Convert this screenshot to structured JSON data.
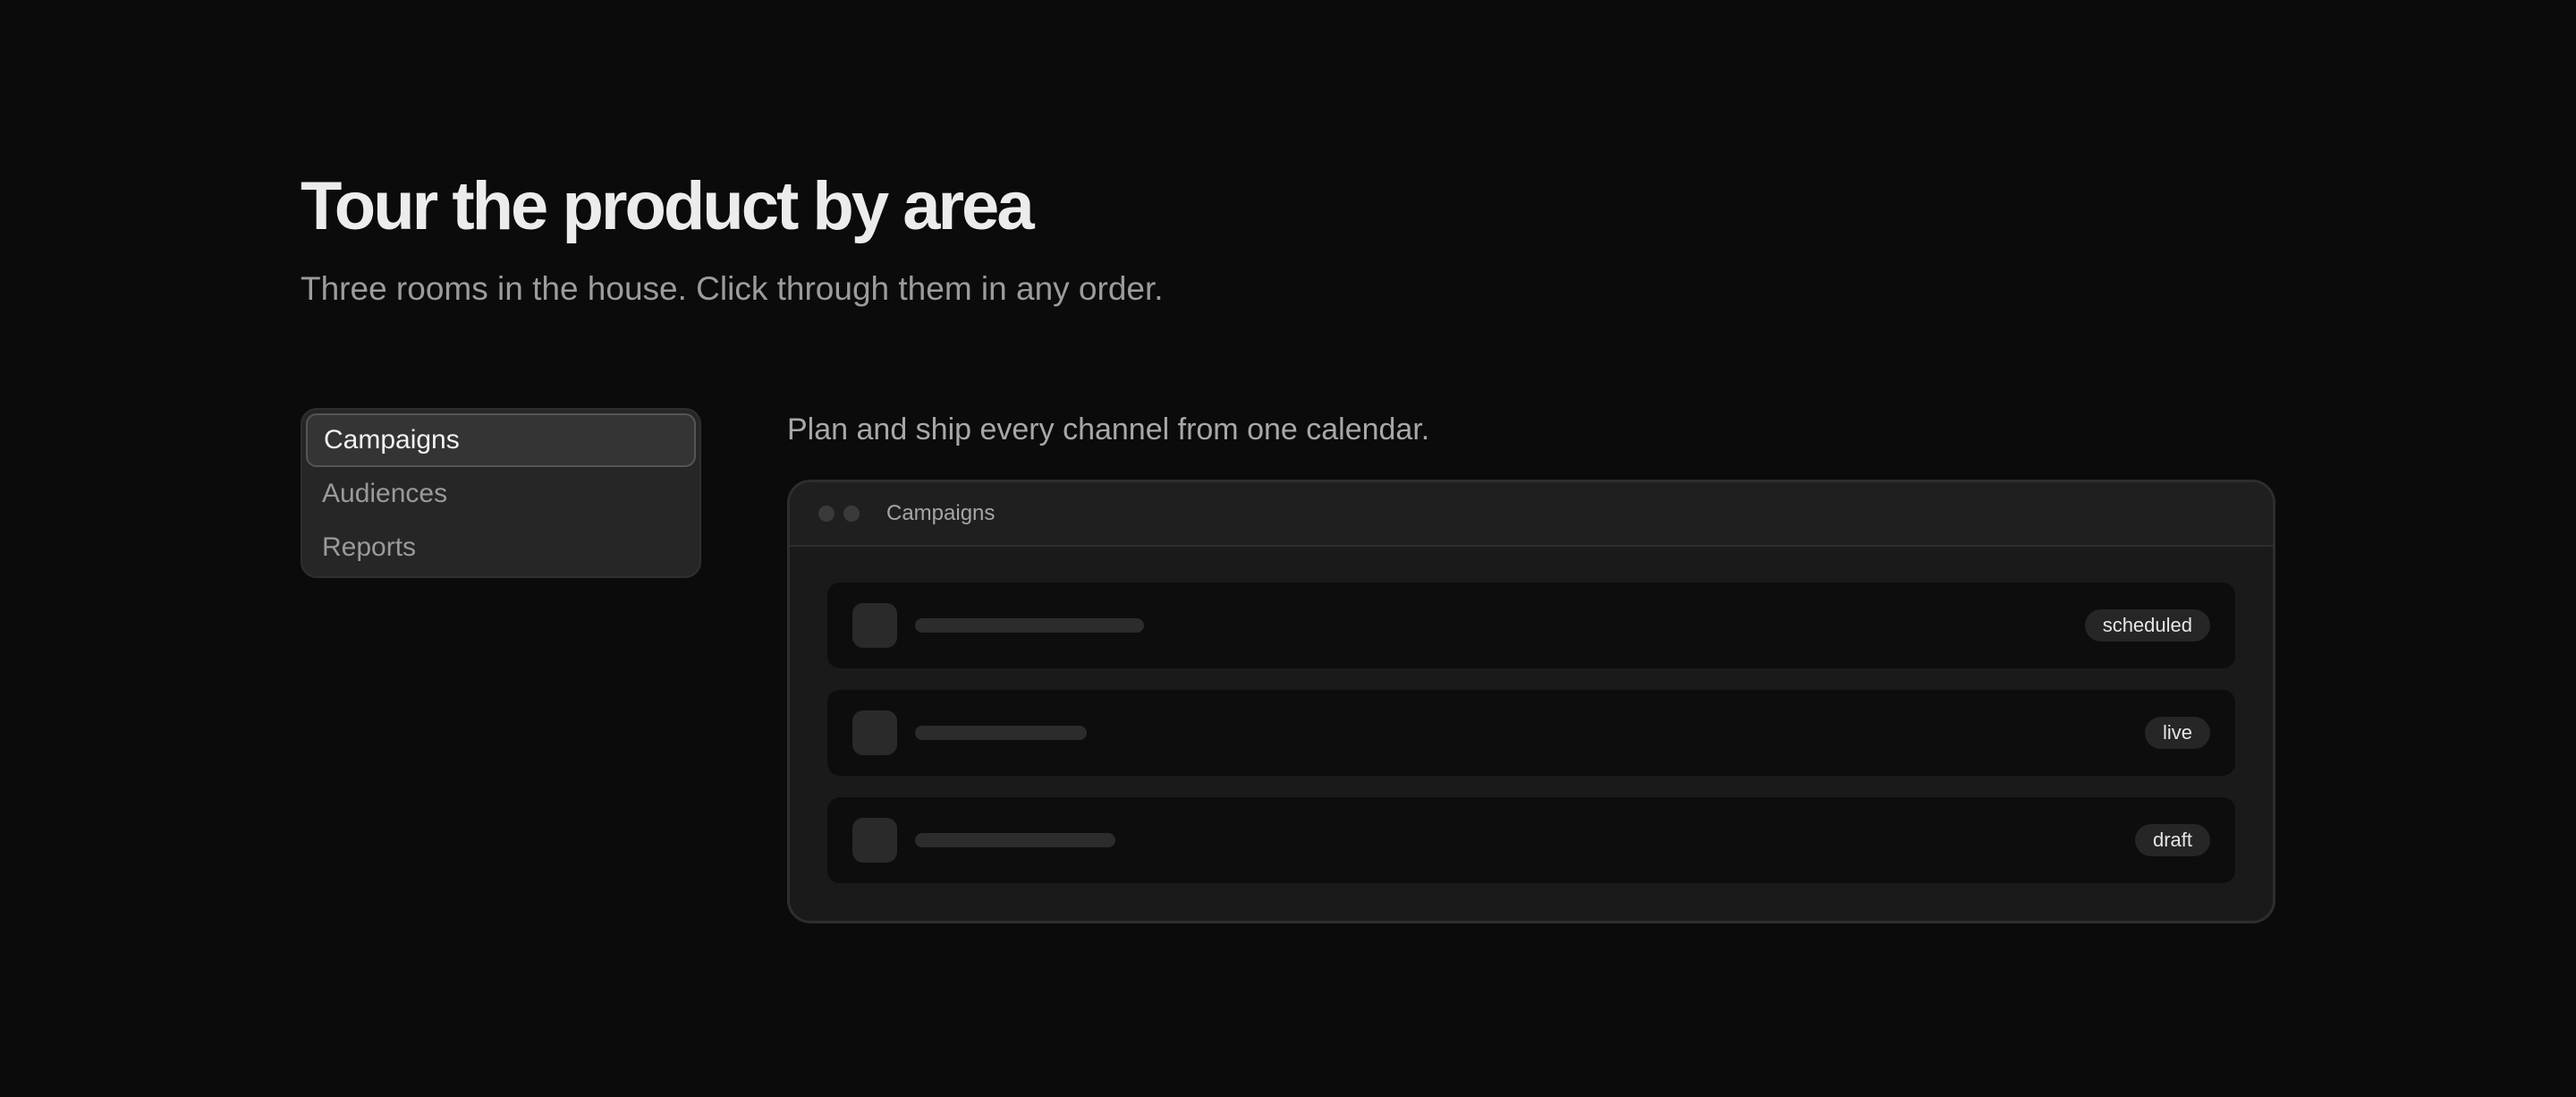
{
  "hero": {
    "title": "Tour the product by area",
    "subtitle": "Three rooms in the house. Click through them in any order."
  },
  "tabs": [
    {
      "label": "Campaigns",
      "active": true
    },
    {
      "label": "Audiences",
      "active": false
    },
    {
      "label": "Reports",
      "active": false
    }
  ],
  "panel": {
    "caption": "Plan and ship every channel from one calendar.",
    "window_title": "Campaigns",
    "rows": [
      {
        "status": "scheduled"
      },
      {
        "status": "live"
      },
      {
        "status": "draft"
      }
    ]
  }
}
